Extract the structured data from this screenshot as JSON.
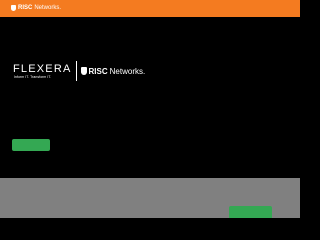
{
  "header": {
    "brand_bold": "RISC",
    "brand_rest": " Networks.",
    "icon": "shield-logo-icon",
    "background": "#f47b20"
  },
  "hero": {
    "flexera_wordmark": "FLEXERA",
    "flexera_tagline": "Inform IT. Transform IT.",
    "risc_bold": "RISC",
    "risc_rest": " Networks.",
    "background": "#000000",
    "button_color": "#34a853"
  },
  "footer": {
    "background": "#808080",
    "button_color": "#34a853"
  }
}
